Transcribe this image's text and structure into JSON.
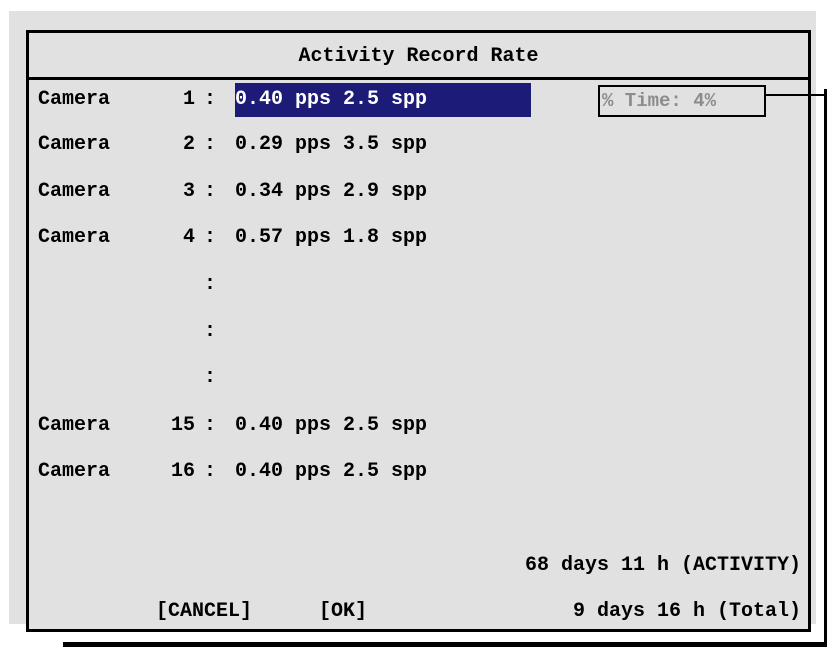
{
  "dialog": {
    "title": "Activity Record Rate"
  },
  "cameras": [
    {
      "label": "Camera",
      "number": "1",
      "sep": ":",
      "rate": "0.40 pps 2.5 spp",
      "selected": true
    },
    {
      "label": "Camera",
      "number": "2",
      "sep": ":",
      "rate": "0.29 pps 3.5 spp"
    },
    {
      "label": "Camera",
      "number": "3",
      "sep": ":",
      "rate": "0.34 pps 2.9 spp"
    },
    {
      "label": "Camera",
      "number": "4",
      "sep": ":",
      "rate": "0.57 pps 1.8 spp"
    },
    {
      "label": "Camera",
      "number": "15",
      "sep": ":",
      "rate": "0.40 pps 2.5 spp"
    },
    {
      "label": "Camera",
      "number": "16",
      "sep": ":",
      "rate": "0.40 pps 2.5 spp"
    }
  ],
  "ellipsis": [
    ":",
    ":",
    ":"
  ],
  "time_box": {
    "text": "% Time: 4%"
  },
  "summary": {
    "activity": "68 days 11 h (ACTIVITY)",
    "total": "9 days 16 h (Total)"
  },
  "buttons": {
    "cancel": "[CANCEL]",
    "ok": "[OK]"
  },
  "colors": {
    "screen_bg": "#e1e1e1",
    "highlight": "#1c1c78",
    "highlight_text": "#ffffff",
    "dim_text": "#8c8c8c"
  }
}
